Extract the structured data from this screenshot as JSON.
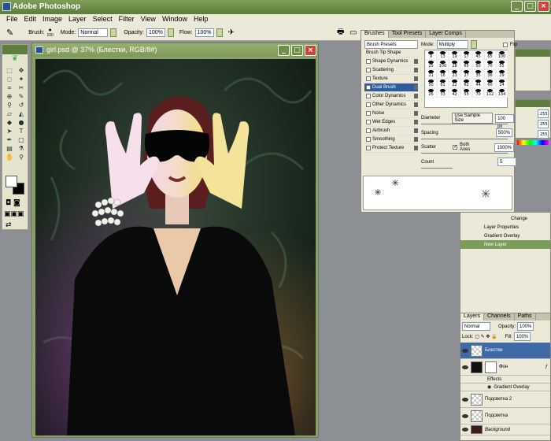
{
  "app": {
    "title": "Adobe Photoshop"
  },
  "menu": [
    "File",
    "Edit",
    "Image",
    "Layer",
    "Select",
    "Filter",
    "View",
    "Window",
    "Help"
  ],
  "options": {
    "brush_label": "Brush:",
    "brush_size": "100",
    "mode_label": "Mode:",
    "mode_value": "Normal",
    "opacity_label": "Opacity:",
    "opacity_value": "100%",
    "flow_label": "Flow:",
    "flow_value": "100%"
  },
  "document": {
    "title": "girl.psd @ 37% (Блестки, RGB/8#)"
  },
  "brushes": {
    "tabs": [
      "Brushes",
      "Tool Presets",
      "Layer Comps"
    ],
    "header": "Brush Presets",
    "items": [
      {
        "label": "Brush Tip Shape",
        "checkbox": false,
        "lock": false
      },
      {
        "label": "Shape Dynamics",
        "checkbox": true,
        "lock": true
      },
      {
        "label": "Scattering",
        "checkbox": true,
        "lock": true
      },
      {
        "label": "Texture",
        "checkbox": true,
        "lock": true
      },
      {
        "label": "Dual Brush",
        "checkbox": true,
        "lock": true,
        "selected": true
      },
      {
        "label": "Color Dynamics",
        "checkbox": true,
        "lock": true
      },
      {
        "label": "Other Dynamics",
        "checkbox": true,
        "lock": true
      },
      {
        "label": "Noise",
        "checkbox": true,
        "lock": true
      },
      {
        "label": "Wet Edges",
        "checkbox": true,
        "lock": true
      },
      {
        "label": "Airbrush",
        "checkbox": true,
        "lock": true
      },
      {
        "label": "Smoothing",
        "checkbox": true,
        "lock": true
      },
      {
        "label": "Protect Texture",
        "checkbox": true,
        "lock": true
      }
    ],
    "mode_label": "Mode:",
    "mode_value": "Multiply",
    "flip_label": "Flip",
    "tips": [
      "9",
      "13",
      "19",
      "17",
      "45",
      "65",
      "100",
      "25",
      "100",
      "28",
      "65",
      "50",
      "70",
      "55",
      "21",
      "16",
      "23",
      "27",
      "35",
      "36",
      "29",
      "50",
      "61",
      "22",
      "62",
      "44",
      "60",
      "14",
      "26",
      "33",
      "42",
      "55",
      "70",
      "112",
      "134"
    ],
    "diameter_label": "Diameter",
    "use_sample_size": "Use Sample Size",
    "diameter_value": "100 px",
    "spacing_label": "Spacing",
    "spacing_value": "500%",
    "scatter_label": "Scatter",
    "both_axes": "Both Axes",
    "scatter_value": "1000%",
    "count_label": "Count",
    "count_value": "5"
  },
  "history": {
    "items": [
      "Change",
      "Layer Properties",
      "Gradient Overlay",
      "New Layer"
    ]
  },
  "layers": {
    "tabs": [
      "Layers",
      "Channels",
      "Paths"
    ],
    "blend_mode": "Normal",
    "opacity_label": "Opacity:",
    "opacity_value": "100%",
    "lock_label": "Lock:",
    "fill_label": "Fill:",
    "fill_value": "100%",
    "rows": [
      "Блестки",
      "Фон",
      "Effects",
      "Gradient Overlay",
      "Подсветка 2",
      "Подсветка",
      "Background"
    ]
  },
  "colors": {
    "accent": "#5f7e3d",
    "selection": "#2f5d9c",
    "panel": "#ece9d8"
  }
}
